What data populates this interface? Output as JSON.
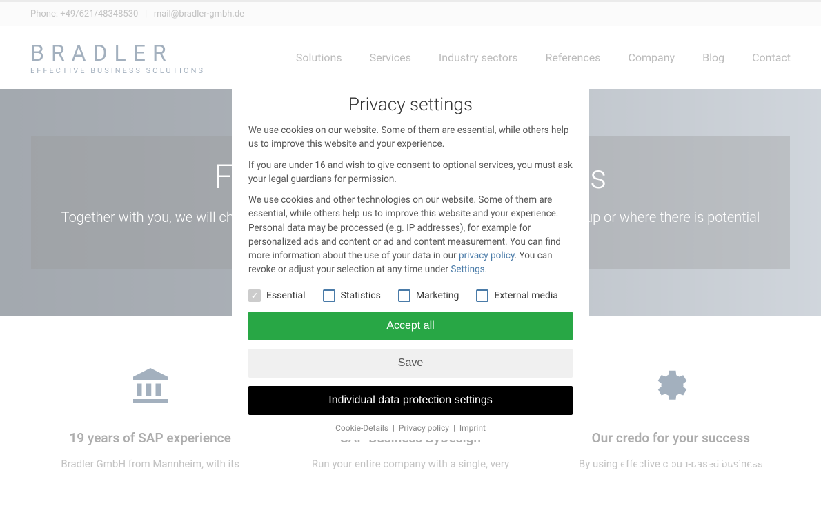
{
  "topbar": {
    "phone_label": "Phone:",
    "phone": "+49/621/48348530",
    "separator": "|",
    "email": "mail@bradler-gmbh.de"
  },
  "logo": {
    "main": "BRADLER",
    "sub": "Effective Business Solutions"
  },
  "nav": {
    "items": [
      "Solutions",
      "Services",
      "Industry sectors",
      "References",
      "Company",
      "Blog",
      "Contact"
    ]
  },
  "hero": {
    "title": "Free SAP potential analysis",
    "text": "Together with you, we will check whether your existing SAP software is already well set up or where there is potential with SAP Business ByDesign."
  },
  "features": [
    {
      "title": "19 years of SAP experience",
      "text": "Bradler GmbH from Mannheim, with its"
    },
    {
      "title": "SAP Business ByDesign",
      "text": "Run your entire company with a single, very"
    },
    {
      "title": "Our credo for your success",
      "text": "By using effective cloud-based business"
    }
  ],
  "modal": {
    "title": "Privacy settings",
    "text1": "We use cookies on our website. Some of them are essential, while others help us to improve this website and your experience.",
    "text2": "If you are under 16 and wish to give consent to optional services, you must ask your legal guardians for permission.",
    "text3a": "We use cookies and other technologies on our website. Some of them are essential, while others help us to improve this website and your experience. Personal data may be processed (e.g. IP addresses), for example for personalized ads and content or ad and content measurement. You can find more information about the use of your data in our ",
    "privacy_link": "privacy policy",
    "text3b": ". You can revoke or adjust your selection at any time under ",
    "settings_link": "Settings",
    "text3c": ".",
    "checks": [
      {
        "label": "Essential",
        "checked": true
      },
      {
        "label": "Statistics",
        "checked": false
      },
      {
        "label": "Marketing",
        "checked": false
      },
      {
        "label": "External media",
        "checked": false
      }
    ],
    "btn_accept": "Accept all",
    "btn_save": "Save",
    "btn_individual": "Individual data protection settings",
    "footer_links": {
      "cookie": "Cookie-Details",
      "privacy": "Privacy policy",
      "imprint": "Imprint",
      "sep": "|"
    }
  },
  "watermark": "Revain"
}
